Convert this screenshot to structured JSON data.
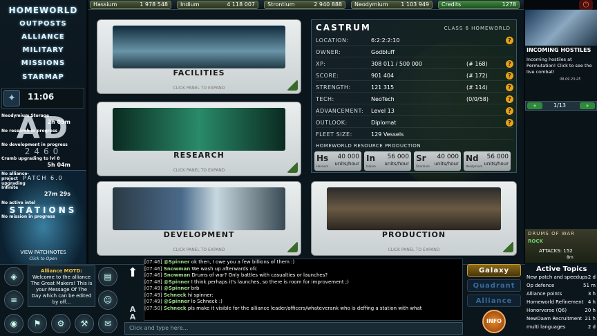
{
  "resources": [
    {
      "name": "Hassium",
      "value": "1 978 548"
    },
    {
      "name": "Indium",
      "value": "4 118 007"
    },
    {
      "name": "Strontium",
      "value": "2 940 888"
    },
    {
      "name": "Neodymium",
      "value": "1 103 949"
    },
    {
      "name": "Credits",
      "value": "1278"
    }
  ],
  "nav": {
    "homeworld": "HOMEWORLD",
    "outposts": "OUTPOSTS",
    "alliance": "ALLIANCE",
    "military": "MILITARY",
    "missions": "MISSIONS",
    "starmap": "STARMAP",
    "clock": "11:06",
    "logo_letters": "AD",
    "logo_year": "2460",
    "patch": "PATCH 6.0",
    "stations": "STATIONS",
    "view_patchnotes": "VIEW PATCHNOTES",
    "click_open": "Click to Open"
  },
  "panels": {
    "facilities": "FACILITIES",
    "research": "RESEARCH",
    "development": "DEVELOPMENT",
    "production": "PRODUCTION",
    "hint": "CLICK PANEL TO EXPAND"
  },
  "station": {
    "name": "CASTRUM",
    "class": "CLASS 6 HOMEWORLD",
    "rows": [
      {
        "label": "LOCATION:",
        "value": "6:2:2:2:10",
        "rank": ""
      },
      {
        "label": "OWNER:",
        "value": "Godbluff",
        "rank": ""
      },
      {
        "label": "XP:",
        "value": "308 011 / 500 000",
        "rank": "(# 168)"
      },
      {
        "label": "SCORE:",
        "value": "901 404",
        "rank": "(# 172)"
      },
      {
        "label": "STRENGTH:",
        "value": "121 315",
        "rank": "(# 114)"
      },
      {
        "label": "TECH:",
        "value": "NeoTech",
        "rank": "(0/0/58)"
      },
      {
        "label": "ADVANCEMENT:",
        "value": "Level 13",
        "rank": ""
      },
      {
        "label": "OUTLOOK:",
        "value": "Diplomat",
        "rank": ""
      },
      {
        "label": "FLEET SIZE:",
        "value": "129 Vessels",
        "rank": ""
      }
    ],
    "production_title": "HOMEWORLD RESOURCE PRODUCTION",
    "production": [
      {
        "sym": "Hs",
        "name": "Hassium",
        "amount": "40 000",
        "unit": "units/hour"
      },
      {
        "sym": "In",
        "name": "Indium",
        "amount": "56 000",
        "unit": "units/hour"
      },
      {
        "sym": "Sr",
        "name": "Strontium",
        "amount": "40 000",
        "unit": "units/hour"
      },
      {
        "sym": "Nd",
        "name": "Neodymium",
        "amount": "56 000",
        "unit": "units/hour"
      }
    ]
  },
  "hostiles": {
    "title": "INCOMING HOSTILES",
    "text": "Incoming hostiles at Permutation! Click to see the live combat!",
    "date": "08.09 23:25",
    "pager": "1/13"
  },
  "queue": [
    {
      "label": "Neodymium Storage",
      "time": "2h 05m"
    },
    {
      "label": "No research in progress",
      "time": ""
    },
    {
      "label": "No development in progress",
      "time": ""
    },
    {
      "label": "Crumb upgrading to lvl 8",
      "time": "5h 04m"
    },
    {
      "label": "No alliance-project upgrading",
      "time": ""
    },
    {
      "label": "Infinite",
      "time": "27m 29s"
    },
    {
      "label": "No active intel",
      "time": ""
    },
    {
      "label": "No mission in progress",
      "time": ""
    }
  ],
  "drums": {
    "title": "DRUMS OF WAR",
    "team": "ROCK",
    "attacks": "ATTACKS: 152",
    "time": "8m"
  },
  "motd": {
    "title": "Alliance MOTD:",
    "text": "Welcome to the alliance The Great Makers! This is your Message Of The Day which can be edited by off..."
  },
  "chat": [
    {
      "time": "[07:46]",
      "nick": "@Spinner",
      "msg": "ok then, I owe you a few billions of them :)"
    },
    {
      "time": "[07:46]",
      "nick": "Snowman",
      "msg": "We wash up afterwards ofc"
    },
    {
      "time": "[07:46]",
      "nick": "Snowman",
      "msg": "Drums of war? Only battles with casualties or launches?"
    },
    {
      "time": "[07:48]",
      "nick": "@Spinner",
      "msg": "I think perhaps it's launches, so there is room for improvement ;)"
    },
    {
      "time": "[07:49]",
      "nick": "@Spinner",
      "msg": "brb"
    },
    {
      "time": "[07:49]",
      "nick": "Schneck",
      "msg": "hi spinner:"
    },
    {
      "time": "[07:49]",
      "nick": "@Spinner",
      "msg": "lo Schneck :)"
    },
    {
      "time": "[07:50]",
      "nick": "Schneck",
      "msg": "pls make it visible for the alliance leader/officers/whateverank who is deffing a station with what"
    }
  ],
  "chat_placeholder": "Click and type here...",
  "modes": {
    "galaxy": "Galaxy",
    "quadrant": "Quadrant",
    "alliance": "Alliance"
  },
  "info_btn": "INFO",
  "topics": {
    "title": "Active Topics",
    "items": [
      {
        "label": "New patch and speedups",
        "time": "2 d"
      },
      {
        "label": "Op defence",
        "time": "51 m"
      },
      {
        "label": "Alliance points",
        "time": "3 h"
      },
      {
        "label": "Homeworld Refinement",
        "time": "4 h"
      },
      {
        "label": "Honorverse (Q6)",
        "time": "20 h"
      },
      {
        "label": "NewDawn Recruitment",
        "time": "21 h"
      },
      {
        "label": "multi languages",
        "time": "2 d"
      }
    ]
  }
}
